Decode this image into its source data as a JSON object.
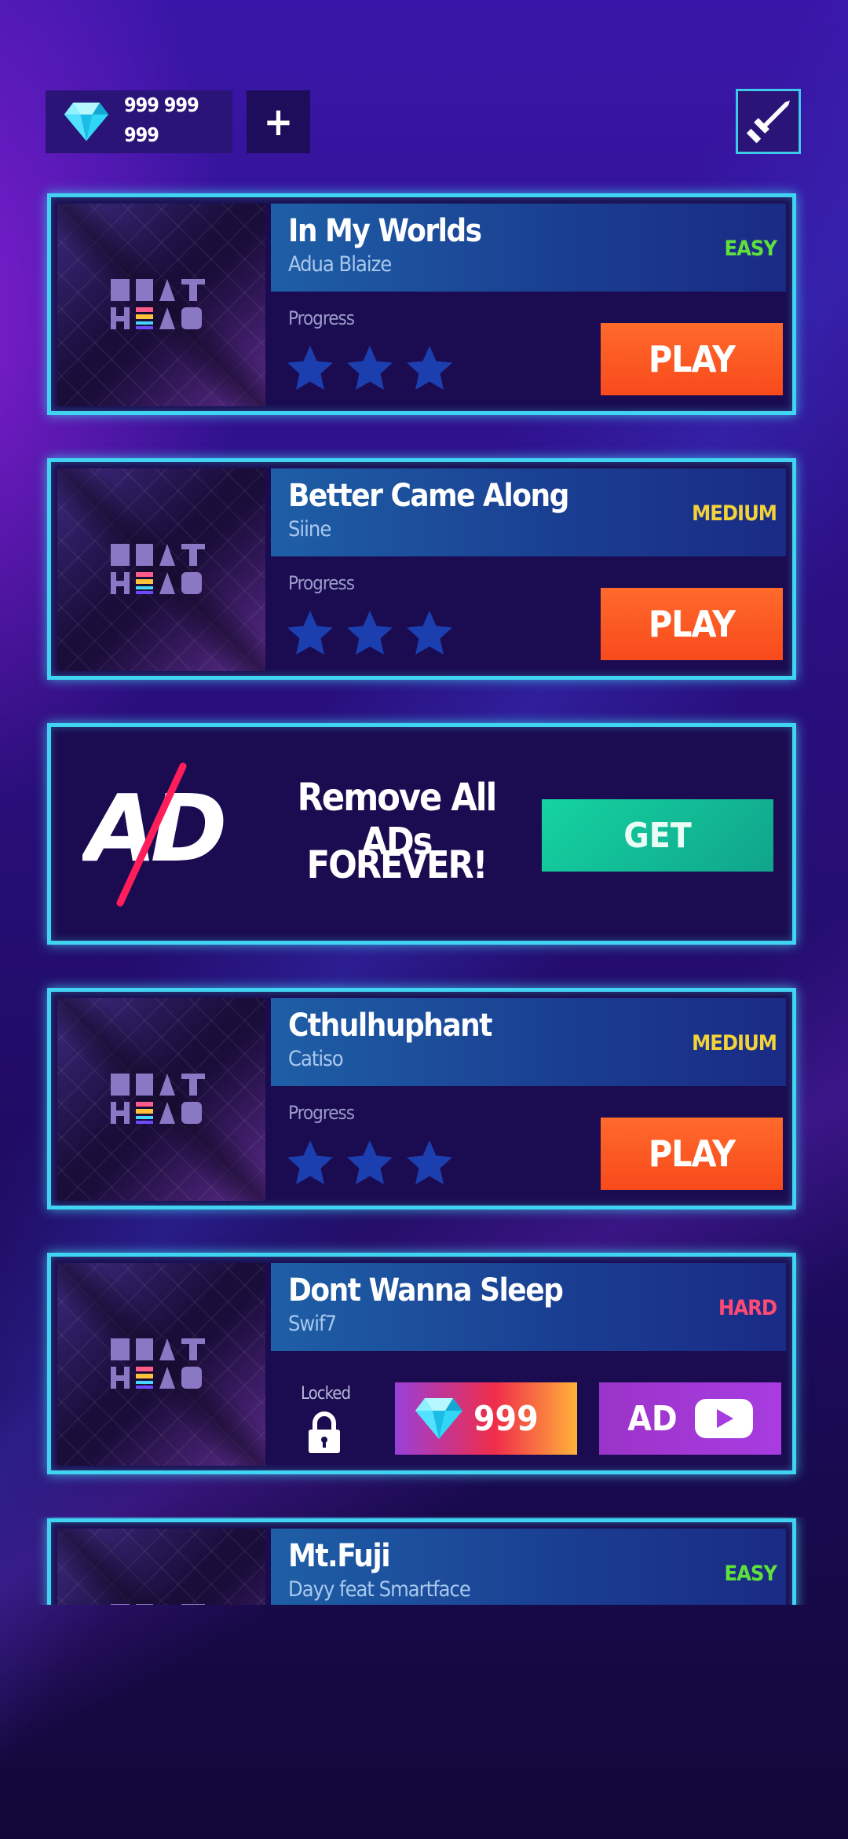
{
  "currency": {
    "amount_line1": "999 999",
    "amount_line2": "999",
    "add_label": "+"
  },
  "songs": [
    {
      "title": "In My Worlds",
      "artist": "Adua Blaize",
      "difficulty": "EASY",
      "difficulty_color": "#5fe03c",
      "progress_label": "Progress",
      "stars_earned": 0,
      "stars_total": 3,
      "play_label": "PLAY"
    },
    {
      "title": "Better Came Along",
      "artist": "Siine",
      "difficulty": "MEDIUM",
      "difficulty_color": "#f2d23a",
      "progress_label": "Progress",
      "stars_earned": 0,
      "stars_total": 3,
      "play_label": "PLAY"
    },
    {
      "title": "Cthulhuphant",
      "artist": "Catiso",
      "difficulty": "MEDIUM",
      "difficulty_color": "#f2d23a",
      "progress_label": "Progress",
      "stars_earned": 0,
      "stars_total": 3,
      "play_label": "PLAY"
    },
    {
      "title": "Dont Wanna Sleep",
      "artist": "Swif7",
      "difficulty": "HARD",
      "difficulty_color": "#ff4a74",
      "locked_label": "Locked",
      "price": "999",
      "ad_label": "AD"
    },
    {
      "title": "Mt.Fuji",
      "artist": "Dayy feat Smartface",
      "difficulty": "EASY",
      "difficulty_color": "#5fe03c"
    }
  ],
  "cover_logo": {
    "line1": "BEAT",
    "line2": "HEAD"
  },
  "ad_offer": {
    "logo_text": "AD",
    "line1": "Remove All ADs",
    "line2": "FOREVER!",
    "get_label": "GET"
  },
  "icons": {
    "gem": "diamond-gem-icon",
    "sword": "sword-icon",
    "star": "star-icon",
    "lock": "lock-icon",
    "video": "play-video-icon"
  },
  "colors": {
    "card_border": "#41d3f2",
    "play_button": "#f85a22",
    "get_button": "#13c39a",
    "star_empty": "#1c3fb0"
  }
}
